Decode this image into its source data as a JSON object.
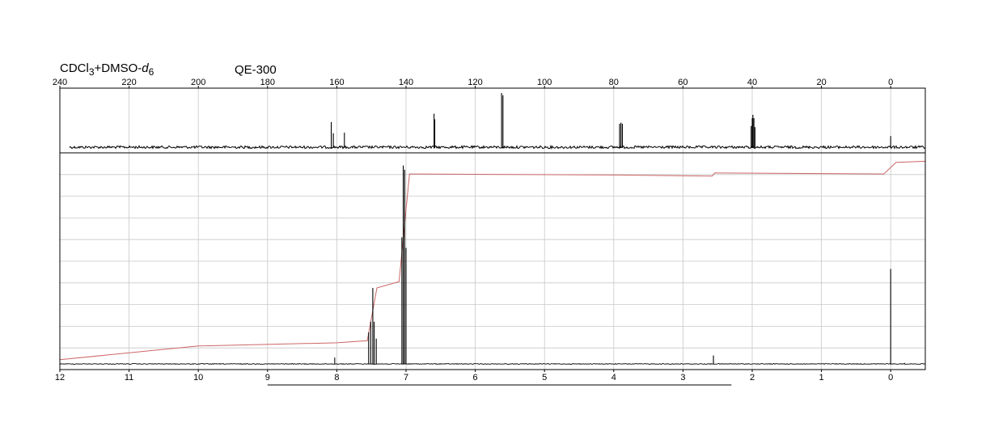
{
  "header": {
    "solvent_a": "CDCl",
    "solvent_a_sub": "3",
    "solvent_b": "+DMSO-",
    "solvent_b_italic": "d",
    "solvent_b_sub": "6",
    "instrument": "QE-300"
  },
  "chart_data": [
    {
      "type": "line",
      "subtype": "13C NMR spectrum",
      "title": "",
      "xlabel": "",
      "ylabel": "",
      "x_axis_reversed": true,
      "x_axis_position": "top",
      "xlim": [
        240,
        -10
      ],
      "ylim": [
        0,
        1
      ],
      "x_ticks": [
        240,
        220,
        200,
        180,
        160,
        140,
        120,
        100,
        80,
        60,
        40,
        20,
        0
      ],
      "x_tick_labels": [
        "240",
        "220",
        "200",
        "180",
        "160",
        "140",
        "120",
        "100",
        "80",
        "60",
        "40",
        "20",
        "0"
      ],
      "grid": true,
      "peaks": [
        {
          "ppm": 161.6,
          "intensity": 0.45
        },
        {
          "ppm": 161.0,
          "intensity": 0.25
        },
        {
          "ppm": 157.8,
          "intensity": 0.26
        },
        {
          "ppm": 131.9,
          "intensity": 0.6
        },
        {
          "ppm": 131.7,
          "intensity": 0.5
        },
        {
          "ppm": 112.4,
          "intensity": 0.97
        },
        {
          "ppm": 112.0,
          "intensity": 0.93
        },
        {
          "ppm": 78.3,
          "intensity": 0.42
        },
        {
          "ppm": 77.9,
          "intensity": 0.44
        },
        {
          "ppm": 77.5,
          "intensity": 0.42
        },
        {
          "ppm": 40.3,
          "intensity": 0.38
        },
        {
          "ppm": 40.0,
          "intensity": 0.52
        },
        {
          "ppm": 39.8,
          "intensity": 0.58
        },
        {
          "ppm": 39.5,
          "intensity": 0.52
        },
        {
          "ppm": 39.2,
          "intensity": 0.36
        },
        {
          "ppm": 0.0,
          "intensity": 0.2
        }
      ],
      "series_color": "#000000"
    },
    {
      "type": "line",
      "subtype": "1H NMR spectrum with integral curve",
      "title": "",
      "xlabel": "",
      "ylabel": "",
      "x_axis_reversed": true,
      "x_axis_position": "bottom",
      "xlim": [
        12,
        -0.5
      ],
      "ylim": [
        0,
        10
      ],
      "x_ticks": [
        12,
        11,
        10,
        9,
        8,
        7,
        6,
        5,
        4,
        3,
        2,
        1,
        0
      ],
      "x_tick_labels": [
        "12",
        "11",
        "10",
        "9",
        "8",
        "7",
        "6",
        "5",
        "4",
        "3",
        "2",
        "1",
        "0"
      ],
      "horizontal_gridlines": 10,
      "grid": true,
      "peaks": [
        {
          "ppm": 8.03,
          "intensity": 0.3
        },
        {
          "ppm": 7.54,
          "intensity": 1.5
        },
        {
          "ppm": 7.51,
          "intensity": 2.0
        },
        {
          "ppm": 7.48,
          "intensity": 3.6
        },
        {
          "ppm": 7.46,
          "intensity": 2.0
        },
        {
          "ppm": 7.43,
          "intensity": 1.2
        },
        {
          "ppm": 7.06,
          "intensity": 6.0
        },
        {
          "ppm": 7.04,
          "intensity": 9.4
        },
        {
          "ppm": 7.02,
          "intensity": 9.2
        },
        {
          "ppm": 7.0,
          "intensity": 5.5
        },
        {
          "ppm": 2.56,
          "intensity": 0.4
        },
        {
          "ppm": 0.0,
          "intensity": 4.5
        },
        {
          "ppm": -0.2,
          "intensity": 0.05
        }
      ],
      "integral_curve": [
        {
          "ppm": 12.0,
          "level": 0.2
        },
        {
          "ppm": 10.0,
          "level": 0.85
        },
        {
          "ppm": 8.0,
          "level": 1.0
        },
        {
          "ppm": 7.56,
          "level": 1.1
        },
        {
          "ppm": 7.42,
          "level": 3.6
        },
        {
          "ppm": 7.1,
          "level": 3.9
        },
        {
          "ppm": 6.95,
          "level": 9.0
        },
        {
          "ppm": 4.0,
          "level": 8.95
        },
        {
          "ppm": 2.58,
          "level": 8.9
        },
        {
          "ppm": 2.54,
          "level": 9.05
        },
        {
          "ppm": 0.1,
          "level": 9.0
        },
        {
          "ppm": -0.08,
          "level": 9.55
        },
        {
          "ppm": -0.5,
          "level": 9.6
        }
      ],
      "integral_range_bar": [
        9.0,
        2.3
      ],
      "series_color": "#000000",
      "integral_color": "#cc6666"
    }
  ]
}
